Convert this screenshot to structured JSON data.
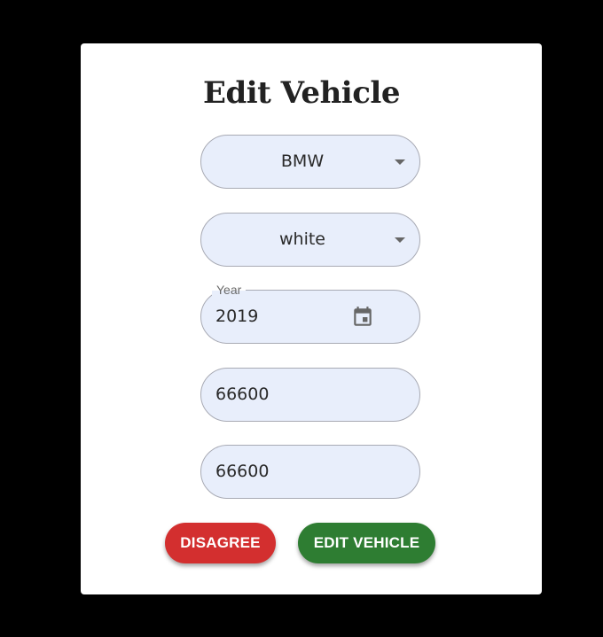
{
  "dialog": {
    "title": "Edit Vehicle",
    "brand_select": {
      "value": "BMW",
      "icon": "caret-down-icon"
    },
    "color_select": {
      "value": "white",
      "icon": "caret-down-icon"
    },
    "year_field": {
      "label": "Year",
      "value": "2019",
      "icon": "calendar-icon"
    },
    "field_4": {
      "value": "66600"
    },
    "field_5": {
      "value": "66600"
    },
    "actions": {
      "disagree_label": "DISAGREE",
      "edit_label": "EDIT VEHICLE"
    }
  },
  "colors": {
    "field_background": "#e8eefb",
    "disagree": "#d32f2f",
    "edit": "#2e7d32"
  }
}
